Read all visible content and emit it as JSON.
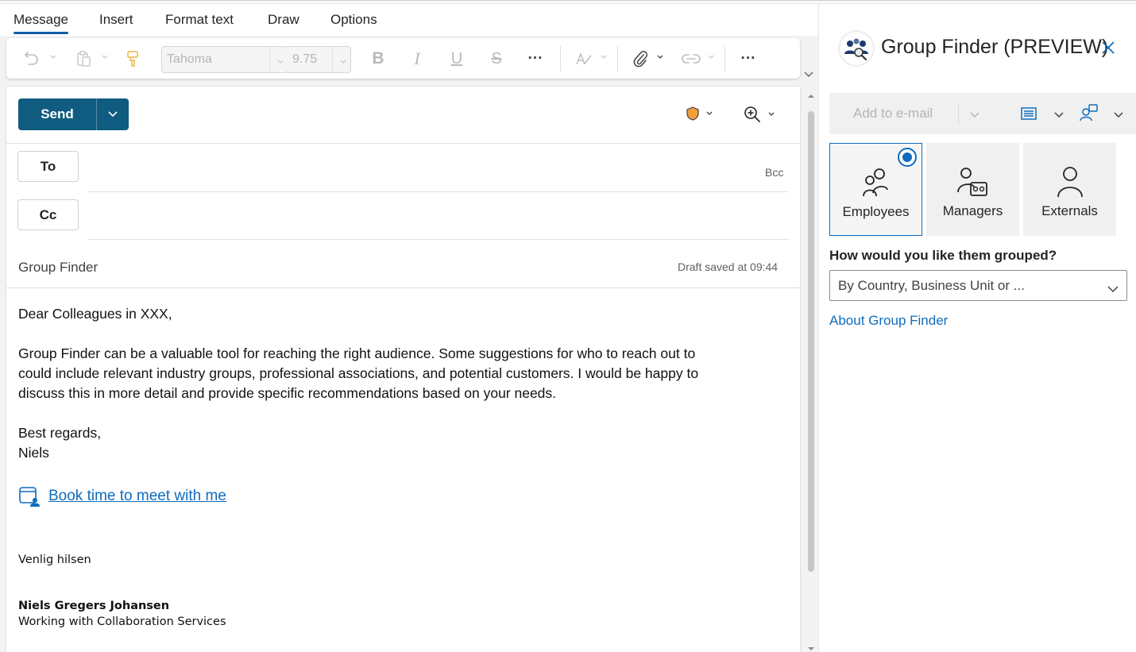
{
  "tabs": [
    {
      "label": "Message",
      "active": true
    },
    {
      "label": "Insert"
    },
    {
      "label": "Format text"
    },
    {
      "label": "Draw"
    },
    {
      "label": "Options"
    }
  ],
  "ribbon": {
    "font_name": "Tahoma",
    "font_size": "9.75",
    "icons": [
      "undo-icon",
      "paste-icon",
      "format-painter-icon",
      "bold-icon",
      "italic-icon",
      "underline-icon",
      "strikethrough-icon",
      "more-formatting-icon",
      "editor-icon",
      "attach-icon",
      "link-icon",
      "more-options-icon"
    ]
  },
  "compose": {
    "send_label": "Send",
    "to_label": "To",
    "cc_label": "Cc",
    "bcc_label": "Bcc",
    "subject": "Group Finder",
    "draft_status": "Draft saved at 09:44",
    "body": {
      "greeting": "Dear  Colleagues in XXX,",
      "para1_line1": "Group Finder can be a valuable tool for reaching the right audience. Some suggestions for who to reach out to",
      "para1_line2": "could include relevant industry groups, professional associations, and potential customers. I would be happy to",
      "para1_line3": "discuss this in more detail and provide specific recommendations based on your needs.",
      "closing": "Best regards,",
      "name": "Niels"
    },
    "booking_link": "Book time to meet with me",
    "signature": {
      "greeting": "Venlig hilsen",
      "name": "Niels Gregers Johansen",
      "title": "Working with Collaboration Services"
    }
  },
  "pane": {
    "title": "Group Finder (PREVIEW)",
    "add_to_email": "Add to e-mail",
    "types": [
      {
        "label": "Employees",
        "selected": true
      },
      {
        "label": "Managers",
        "selected": false
      },
      {
        "label": "Externals",
        "selected": false
      }
    ],
    "group_question": "How would you like them grouped?",
    "group_selected": "By Country, Business Unit or ...",
    "about_link": "About Group Finder"
  },
  "colors": {
    "accent": "#0f6cbd",
    "send_button": "#0f5c80",
    "sensitivity_shield": "#f29d38"
  }
}
